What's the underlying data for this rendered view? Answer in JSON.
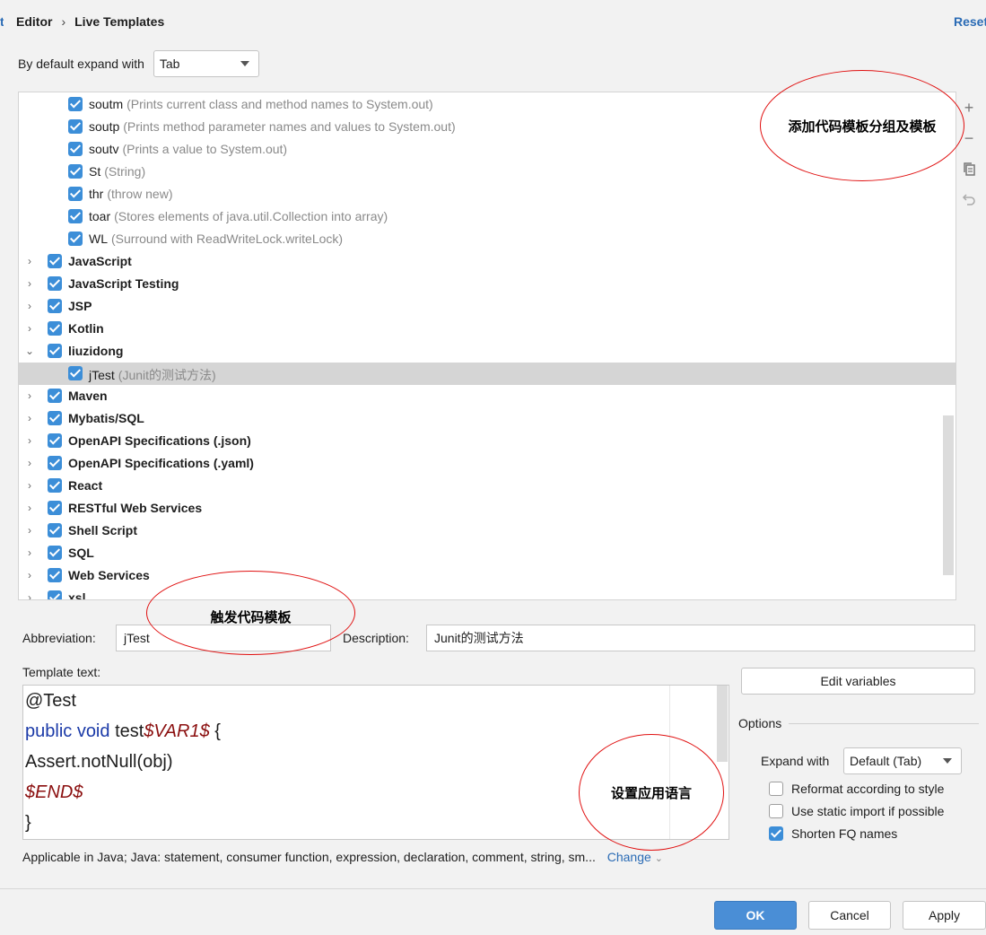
{
  "breadcrumb": {
    "root": "Editor",
    "separator": "›",
    "current": "Live Templates"
  },
  "edge_fragment": "t",
  "reset_label": "Reset",
  "expand_default": {
    "label": "By default expand with",
    "value": "Tab"
  },
  "tree": {
    "rows": [
      {
        "type": "item",
        "abbr": "soutm",
        "desc": "(Prints current class and method names to System.out)",
        "checked": true
      },
      {
        "type": "item",
        "abbr": "soutp",
        "desc": "(Prints method parameter names and values to System.out)",
        "checked": true
      },
      {
        "type": "item",
        "abbr": "soutv",
        "desc": "(Prints a value to System.out)",
        "checked": true
      },
      {
        "type": "item",
        "abbr": "St",
        "desc": "(String)",
        "checked": true
      },
      {
        "type": "item",
        "abbr": "thr",
        "desc": "(throw new)",
        "checked": true
      },
      {
        "type": "item",
        "abbr": "toar",
        "desc": "(Stores elements of java.util.Collection into array)",
        "checked": true
      },
      {
        "type": "item",
        "abbr": "WL",
        "desc": "(Surround with ReadWriteLock.writeLock)",
        "checked": true
      },
      {
        "type": "group",
        "name": "JavaScript",
        "expanded": false,
        "checked": true
      },
      {
        "type": "group",
        "name": "JavaScript Testing",
        "expanded": false,
        "checked": true
      },
      {
        "type": "group",
        "name": "JSP",
        "expanded": false,
        "checked": true
      },
      {
        "type": "group",
        "name": "Kotlin",
        "expanded": false,
        "checked": true
      },
      {
        "type": "group",
        "name": "liuzidong",
        "expanded": true,
        "checked": true
      },
      {
        "type": "item",
        "abbr": "jTest",
        "desc": "(Junit的测试方法)",
        "checked": true,
        "selected": true
      },
      {
        "type": "group",
        "name": "Maven",
        "expanded": false,
        "checked": true
      },
      {
        "type": "group",
        "name": "Mybatis/SQL",
        "expanded": false,
        "checked": true
      },
      {
        "type": "group",
        "name": "OpenAPI Specifications (.json)",
        "expanded": false,
        "checked": true
      },
      {
        "type": "group",
        "name": "OpenAPI Specifications (.yaml)",
        "expanded": false,
        "checked": true
      },
      {
        "type": "group",
        "name": "React",
        "expanded": false,
        "checked": true
      },
      {
        "type": "group",
        "name": "RESTful Web Services",
        "expanded": false,
        "checked": true
      },
      {
        "type": "group",
        "name": "Shell Script",
        "expanded": false,
        "checked": true
      },
      {
        "type": "group",
        "name": "SQL",
        "expanded": false,
        "checked": true
      },
      {
        "type": "group",
        "name": "Web Services",
        "expanded": false,
        "checked": true
      },
      {
        "type": "group",
        "name": "xsl",
        "expanded": false,
        "checked": true
      }
    ]
  },
  "toolbar": {
    "add": "+",
    "remove": "−",
    "copy": "copy-icon",
    "restore": "undo-icon"
  },
  "annotations": {
    "add_group": "添加代码模板分组及模板",
    "trigger": "触发代码模板",
    "language": "设置应用语言"
  },
  "abbreviation": {
    "label": "Abbreviation:",
    "value": "jTest"
  },
  "description": {
    "label": "Description:",
    "value": "Junit的测试方法"
  },
  "template_text": {
    "label": "Template text:",
    "lines": [
      [
        {
          "t": "@Test",
          "c": "plain"
        }
      ],
      [
        {
          "t": "public void ",
          "c": "kw"
        },
        {
          "t": "test",
          "c": "plain"
        },
        {
          "t": "$VAR1$",
          "c": "var"
        },
        {
          "t": " {",
          "c": "plain"
        }
      ],
      [
        {
          "t": "Assert.notNull(obj)",
          "c": "plain"
        }
      ],
      [
        {
          "t": "$END$",
          "c": "var"
        }
      ],
      [
        {
          "t": "}",
          "c": "plain"
        }
      ]
    ]
  },
  "edit_variables": "Edit variables",
  "options": {
    "title": "Options",
    "expand_label": "Expand with",
    "expand_value": "Default (Tab)",
    "checks": [
      {
        "label": "Reformat according to style",
        "checked": false
      },
      {
        "label": "Use static import if possible",
        "checked": false
      },
      {
        "label": "Shorten FQ names",
        "checked": true
      }
    ]
  },
  "applicable": {
    "text": "Applicable in Java; Java: statement, consumer function, expression, declaration, comment, string, sm...",
    "change": "Change"
  },
  "buttons": {
    "ok": "OK",
    "cancel": "Cancel",
    "apply": "Apply"
  },
  "colors": {
    "accent": "#3c8ed8",
    "annotation": "#e01010",
    "link": "#2a6bb5"
  }
}
